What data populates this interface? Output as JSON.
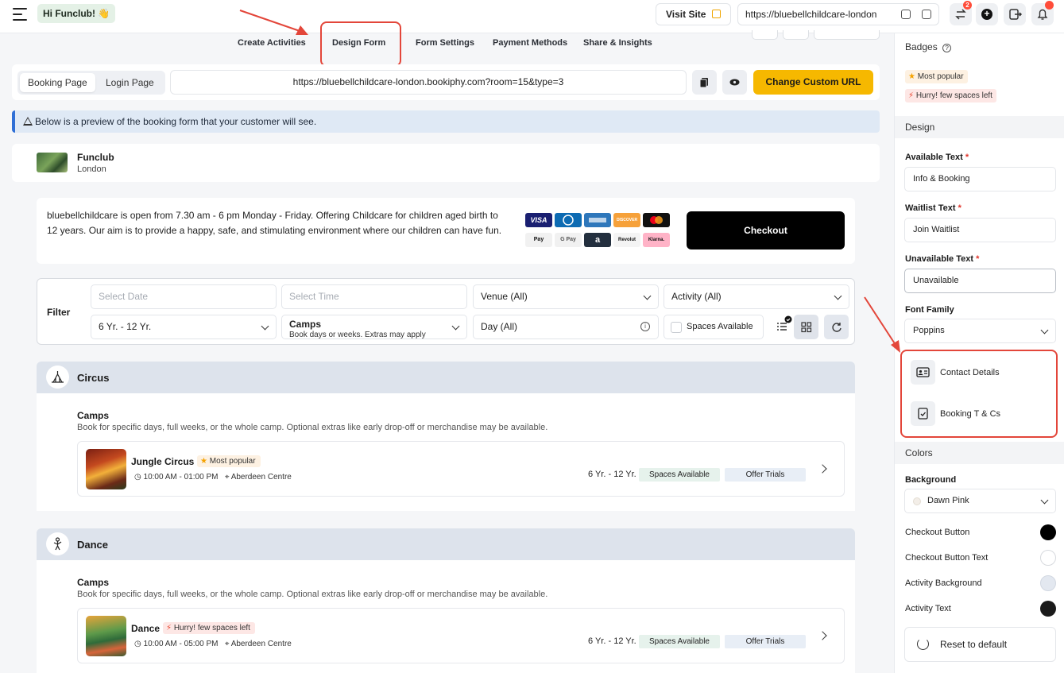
{
  "header": {
    "greeting": "Hi Funclub! 👋",
    "visit_site": "Visit Site",
    "site_url": "https://bluebellchildcare-london",
    "notif_badge": "2"
  },
  "tabs": [
    {
      "label": "Create Activities"
    },
    {
      "label": "Design Form"
    },
    {
      "label": "Form Settings"
    },
    {
      "label": "Payment Methods"
    },
    {
      "label": "Share & Insights"
    }
  ],
  "url_card": {
    "seg_booking": "Booking Page",
    "seg_login": "Login Page",
    "booking_url": "https://bluebellchildcare-london.bookiphy.com?room=15&type=3",
    "change_url": "Change Custom URL"
  },
  "notice": "Below is a preview of the booking form that your customer will see.",
  "org": {
    "name": "Funclub",
    "location": "London"
  },
  "description": "bluebellchildcare is open from 7.30 am - 6 pm Monday - Friday. Offering Childcare for children aged birth to 12 years. Our aim is to provide a happy, safe, and stimulating environment where our children can have fun.",
  "payments": [
    "VISA",
    "",
    "",
    "DISCOVER",
    "",
    "Pay",
    "G Pay",
    "a",
    "Revolut",
    "Klarna."
  ],
  "checkout": "Checkout",
  "filter": {
    "label": "Filter",
    "date_placeholder": "Select Date",
    "time_placeholder": "Select Time",
    "venue": "Venue (All)",
    "activity": "Activity (All)",
    "age": "6 Yr. - 12 Yr.",
    "camps_title": "Camps",
    "camps_sub": "Book days or weeks. Extras may apply",
    "day": "Day (All)",
    "spaces": "Spaces Available"
  },
  "categories": [
    {
      "title": "Circus",
      "sub_title": "Camps",
      "sub_desc": "Book for specific days, full weeks, or the whole camp. Optional extras like early drop-off or merchandise may be available.",
      "activity": {
        "name": "Jungle Circus",
        "badge": "Most popular",
        "time": "10:00 AM - 01:00 PM",
        "venue": "Aberdeen Centre",
        "age": "6 Yr. - 12 Yr.",
        "spaces": "Spaces Available",
        "trials": "Offer Trials"
      }
    },
    {
      "title": "Dance",
      "sub_title": "Camps",
      "sub_desc": "Book for specific days, full weeks, or the whole camp. Optional extras like early drop-off or merchandise may be available.",
      "activity": {
        "name": "Dance",
        "badge": "Hurry! few spaces left",
        "time": "10:00 AM - 05:00 PM",
        "venue": "Aberdeen Centre",
        "age": "6 Yr. - 12 Yr.",
        "spaces": "Spaces Available",
        "trials": "Offer Trials"
      }
    }
  ],
  "panel": {
    "badges_label": "Badges",
    "badge_popular": "Most popular",
    "badge_hurry": "Hurry! few spaces left",
    "design_label": "Design",
    "available_label": "Available Text",
    "available_value": "Info & Booking",
    "waitlist_label": "Waitlist Text",
    "waitlist_value": "Join Waitlist",
    "unavailable_label": "Unavailable Text",
    "unavailable_value": "Unavailable",
    "font_label": "Font Family",
    "font_value": "Poppins",
    "contact_details": "Contact Details",
    "booking_tcs": "Booking T & Cs",
    "colors_label": "Colors",
    "background_label": "Background",
    "background_value": "Dawn Pink",
    "checkout_button": "Checkout Button",
    "checkout_button_text": "Checkout Button Text",
    "activity_background": "Activity Background",
    "activity_text": "Activity Text",
    "reset": "Reset to default",
    "colors": {
      "checkout_button": "#000000",
      "checkout_button_text": "#ffffff",
      "activity_background": "#e3e8f0",
      "activity_text": "#1a1a1a",
      "background": "#f3eee8"
    }
  },
  "accent": {
    "highlight": "#e3463a",
    "primary": "#f6b800"
  }
}
